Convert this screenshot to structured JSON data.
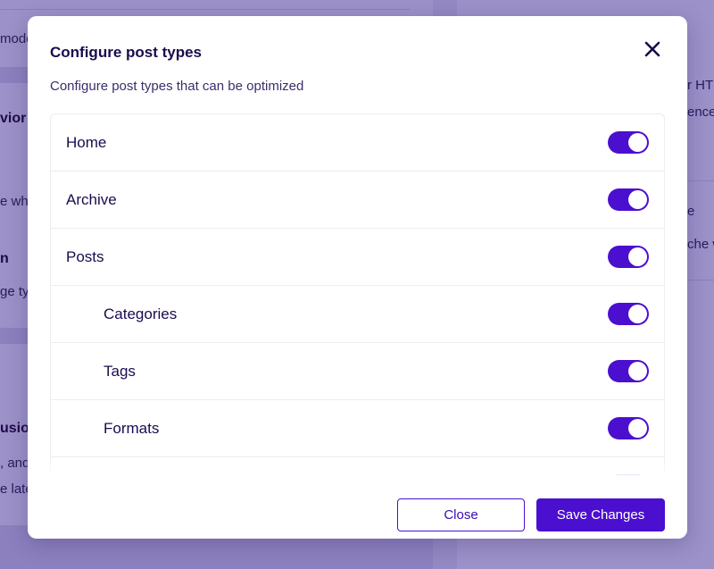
{
  "background": {
    "left_texts": [
      "mode",
      "vior",
      "e wh",
      "n",
      "ge ty",
      "usion",
      ", and",
      "e late"
    ],
    "right_texts": [
      "r HT",
      "ence",
      "e",
      "che w"
    ]
  },
  "modal": {
    "title": "Configure post types",
    "subtitle": "Configure post types that can be optimized",
    "close_icon": "close-x-icon",
    "rows": [
      {
        "label": "Home",
        "enabled": true,
        "indent": false
      },
      {
        "label": "Archive",
        "enabled": true,
        "indent": false
      },
      {
        "label": "Posts",
        "enabled": true,
        "indent": false
      },
      {
        "label": "Categories",
        "enabled": true,
        "indent": true
      },
      {
        "label": "Tags",
        "enabled": true,
        "indent": true
      },
      {
        "label": "Formats",
        "enabled": true,
        "indent": true
      }
    ],
    "buttons": {
      "close_label": "Close",
      "save_label": "Save Changes"
    }
  },
  "colors": {
    "accent": "#4b0fcf",
    "overlay": "#9489c2",
    "text_dark": "#1b0b4d"
  }
}
